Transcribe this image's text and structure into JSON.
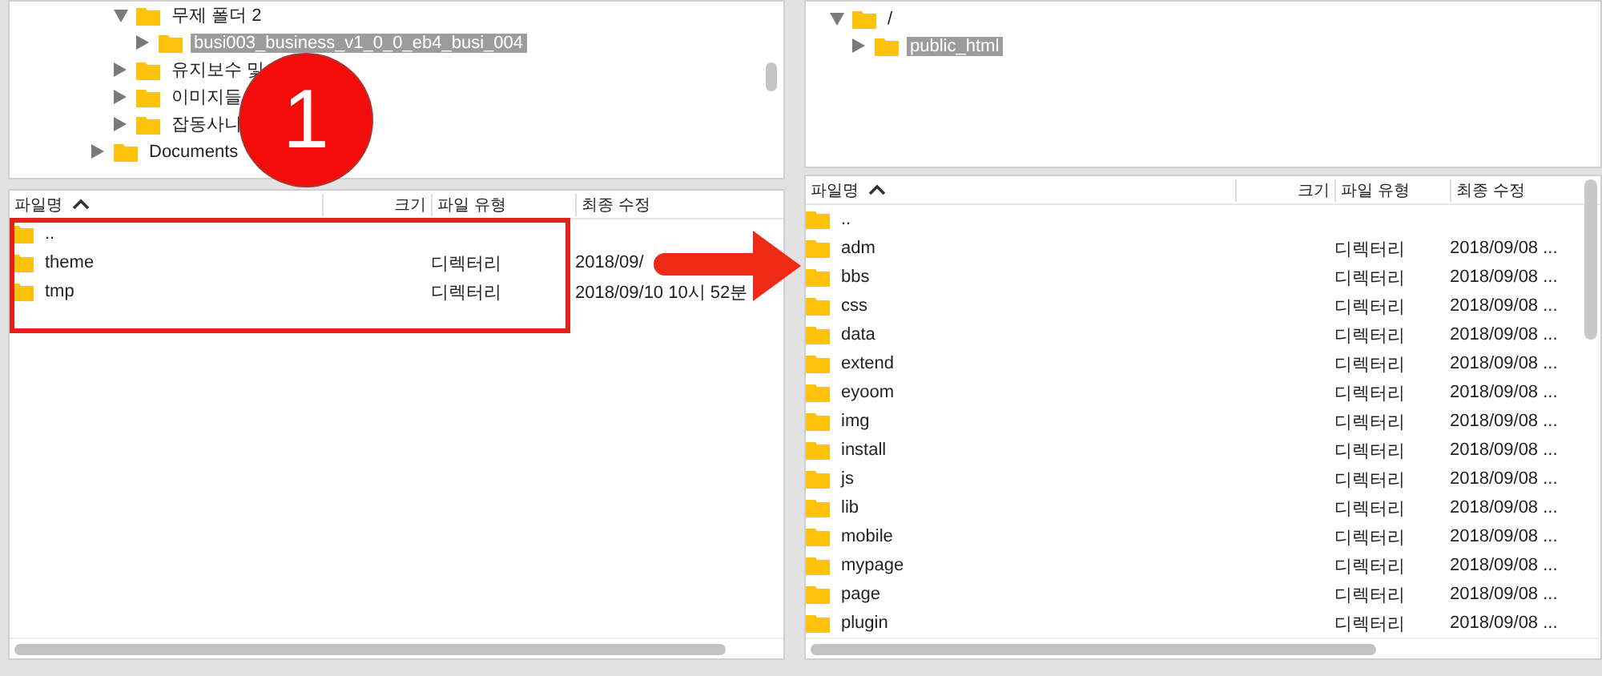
{
  "local": {
    "tree": {
      "continued_children": [
        {
          "label": "무제 폴더 2",
          "expanded": true,
          "selected": false,
          "children": [
            {
              "label": "busi003_business_v1_0_0_eb4_busi_004",
              "expanded": false,
              "selected": true
            }
          ]
        },
        {
          "label": "유지보수 및",
          "expanded": false,
          "selected": false
        },
        {
          "label": "이미지들",
          "expanded": false,
          "selected": false
        },
        {
          "label": "잡동사니",
          "expanded": false,
          "selected": false
        }
      ],
      "items": [
        {
          "label": "Documents",
          "expanded": false,
          "selected": false
        }
      ]
    },
    "list": {
      "columns": [
        "파일명",
        "크기",
        "파일 유형",
        "최종 수정"
      ],
      "rows": [
        {
          "name": ".."
        },
        {
          "name": "theme",
          "type": "디렉터리",
          "modified": "2018/09/"
        },
        {
          "name": "tmp",
          "type": "디렉터리",
          "modified": "2018/09/10 10시 52분"
        }
      ]
    }
  },
  "remote": {
    "tree": {
      "items": [
        {
          "label": "/",
          "expanded": true,
          "selected": false,
          "children": [
            {
              "label": "public_html",
              "expanded": false,
              "selected": true
            }
          ]
        }
      ]
    },
    "list": {
      "columns": [
        "파일명",
        "크기",
        "파일 유형",
        "최종 수정"
      ],
      "rows": [
        {
          "name": ".."
        },
        {
          "name": "adm",
          "type": "디렉터리",
          "modified": "2018/09/08 ..."
        },
        {
          "name": "bbs",
          "type": "디렉터리",
          "modified": "2018/09/08 ..."
        },
        {
          "name": "css",
          "type": "디렉터리",
          "modified": "2018/09/08 ..."
        },
        {
          "name": "data",
          "type": "디렉터리",
          "modified": "2018/09/08 ..."
        },
        {
          "name": "extend",
          "type": "디렉터리",
          "modified": "2018/09/08 ..."
        },
        {
          "name": "eyoom",
          "type": "디렉터리",
          "modified": "2018/09/08 ..."
        },
        {
          "name": "img",
          "type": "디렉터리",
          "modified": "2018/09/08 ..."
        },
        {
          "name": "install",
          "type": "디렉터리",
          "modified": "2018/09/08 ..."
        },
        {
          "name": "js",
          "type": "디렉터리",
          "modified": "2018/09/08 ..."
        },
        {
          "name": "lib",
          "type": "디렉터리",
          "modified": "2018/09/08 ..."
        },
        {
          "name": "mobile",
          "type": "디렉터리",
          "modified": "2018/09/08 ..."
        },
        {
          "name": "mypage",
          "type": "디렉터리",
          "modified": "2018/09/08 ..."
        },
        {
          "name": "page",
          "type": "디렉터리",
          "modified": "2018/09/08 ..."
        },
        {
          "name": "plugin",
          "type": "디렉터리",
          "modified": "2018/09/08 ..."
        }
      ]
    }
  },
  "step_badge": "1"
}
